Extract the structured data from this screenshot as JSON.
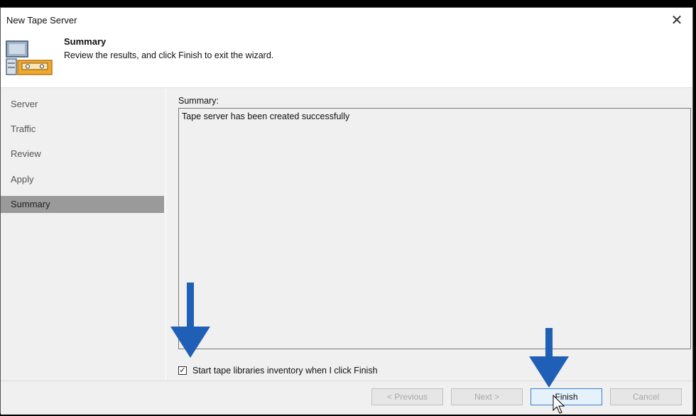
{
  "window": {
    "title": "New Tape Server"
  },
  "header": {
    "title": "Summary",
    "subtitle": "Review the results, and click Finish to exit the wizard."
  },
  "sidebar": {
    "items": [
      {
        "label": "Server",
        "active": false
      },
      {
        "label": "Traffic",
        "active": false
      },
      {
        "label": "Review",
        "active": false
      },
      {
        "label": "Apply",
        "active": false
      },
      {
        "label": "Summary",
        "active": true
      }
    ]
  },
  "main": {
    "summary_label": "Summary:",
    "summary_text": "Tape server has been created successfully",
    "checkbox": {
      "label": "Start tape libraries inventory when I click Finish",
      "checked": true
    }
  },
  "footer": {
    "previous_label": "< Previous",
    "next_label": "Next >",
    "finish_label": "Finish",
    "cancel_label": "Cancel"
  },
  "colors": {
    "accent": "#3b7fd1",
    "annotation_arrow": "#1f5fb5",
    "sidebar_active": "#9a9a9a"
  }
}
